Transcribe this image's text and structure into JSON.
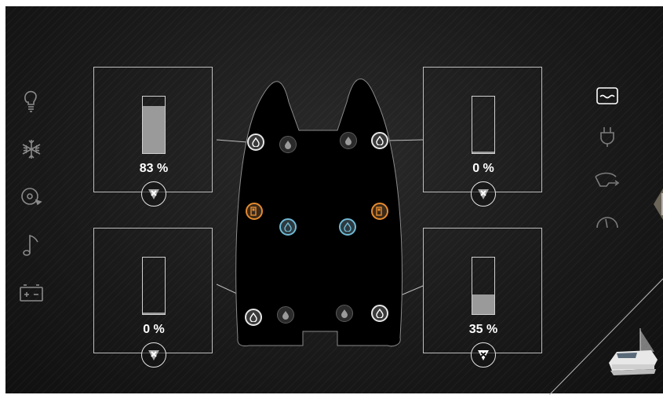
{
  "tanks": {
    "front_left": {
      "percent_label": "83 %",
      "level": 0.83
    },
    "front_right": {
      "percent_label": "0 %",
      "level": 0.03
    },
    "rear_left": {
      "percent_label": "0 %",
      "level": 0.03
    },
    "rear_right": {
      "percent_label": "35 %",
      "level": 0.35
    }
  },
  "colors": {
    "accent_blue": "#6fb9d4",
    "accent_orange": "#e68a2e",
    "panel_border": "#bdbdbd",
    "gauge_fill": "#9a9a9a"
  },
  "left_nav_icons": [
    "lightbulb-icon",
    "climate-icon",
    "location-icon",
    "music-icon",
    "battery-icon"
  ],
  "right_nav_icons": [
    "tank-levels-icon",
    "plug-icon",
    "watermaker-icon",
    "gauge-icon"
  ]
}
